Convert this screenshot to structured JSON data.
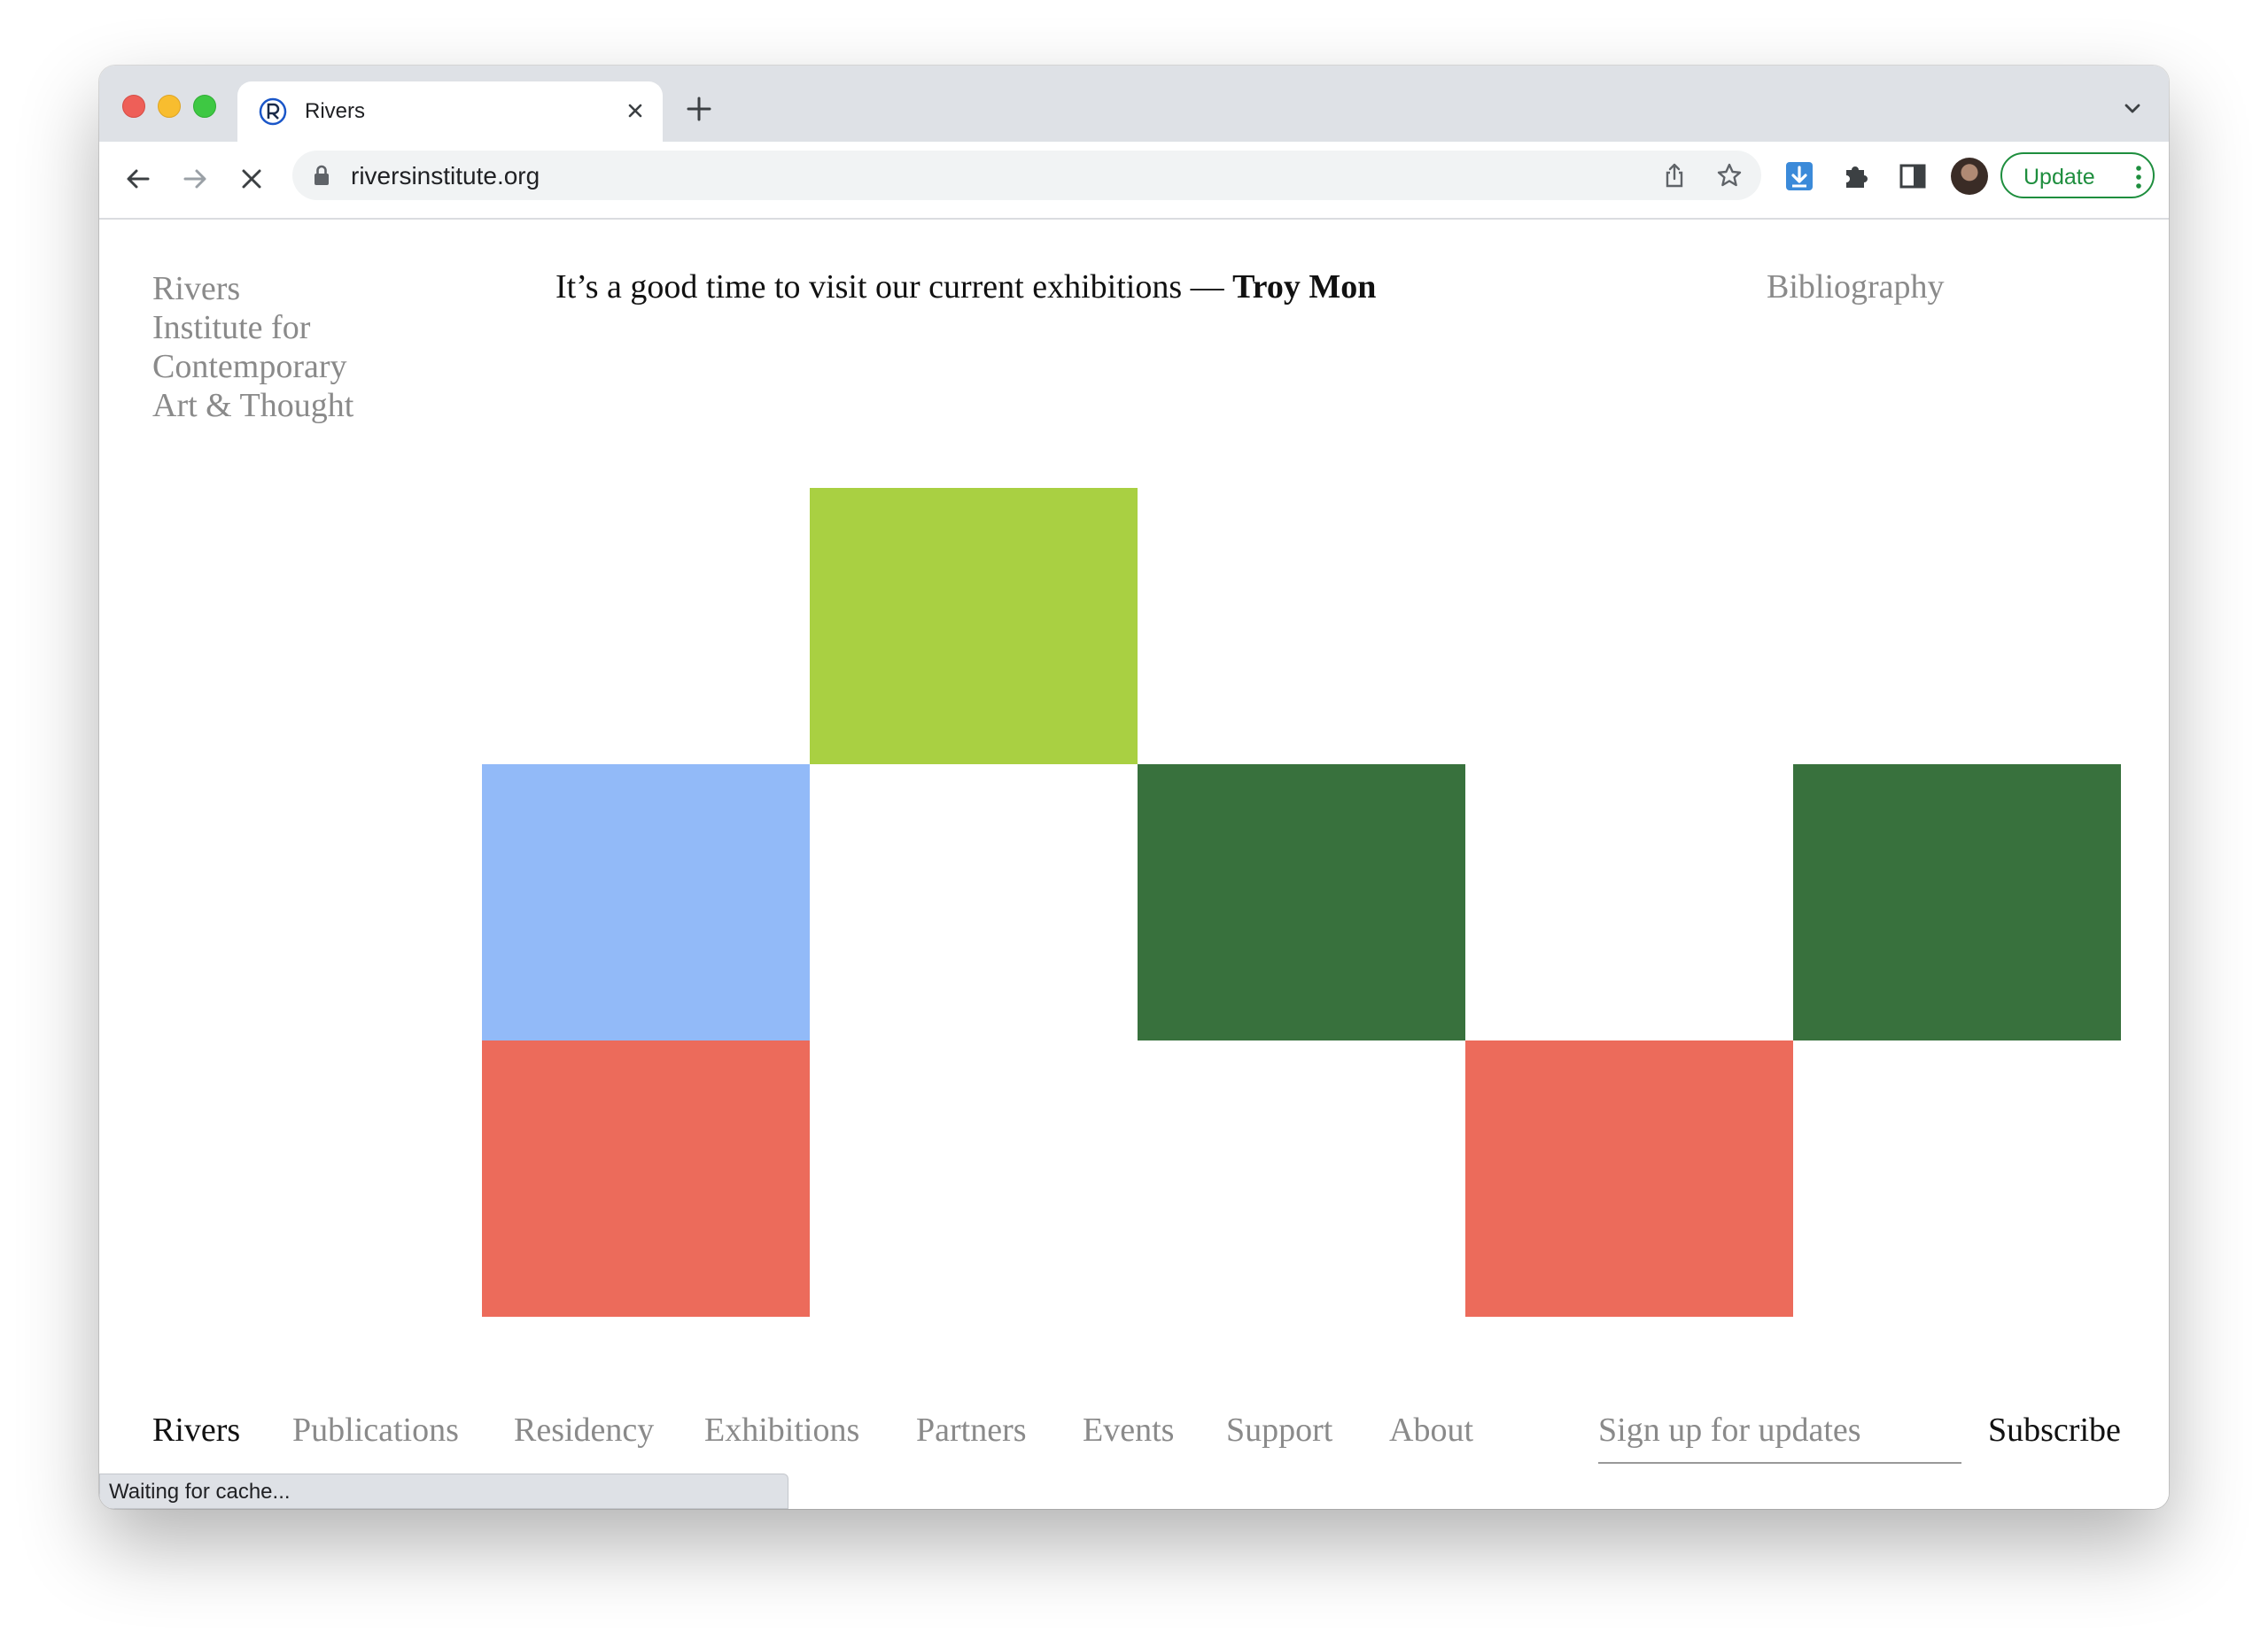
{
  "browser": {
    "tab_title": "Rivers",
    "url": "riversinstitute.org",
    "update_label": "Update",
    "status_text": "Waiting for cache..."
  },
  "site": {
    "logo_lines": [
      "Rivers",
      "Institute for",
      "Contemporary",
      "Art & Thought"
    ],
    "headline_text": "It’s a good time to visit our current exhibitions — ",
    "headline_name": "Troy Mon",
    "bibliography": "Bibliography"
  },
  "colors": {
    "lime": "#a9d042",
    "light_blue": "#92baf8",
    "dark_green": "#38713d",
    "coral": "#ec6b5b",
    "update_green": "#1e8e3e"
  },
  "nav": {
    "items": [
      "Rivers",
      "Publications",
      "Residency",
      "Exhibitions",
      "Partners",
      "Events",
      "Support",
      "About"
    ],
    "signup_placeholder": "Sign up for updates",
    "subscribe": "Subscribe"
  }
}
